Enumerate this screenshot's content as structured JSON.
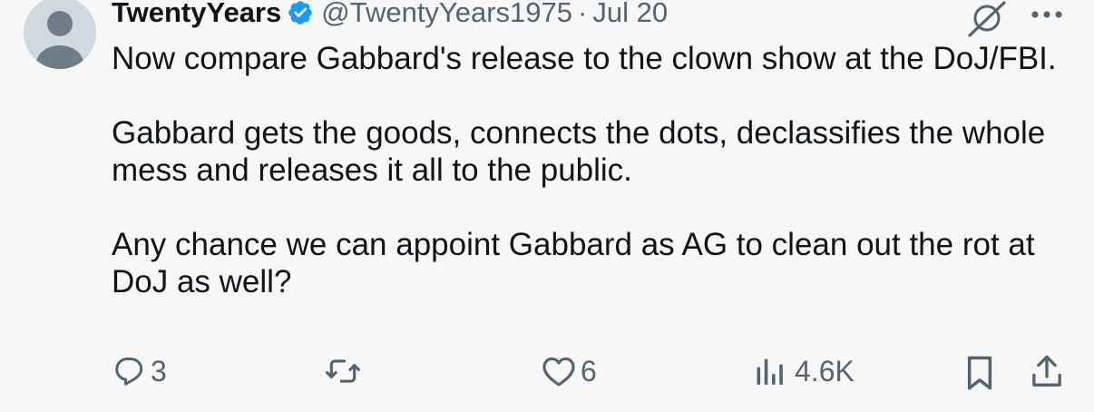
{
  "tweet": {
    "author": {
      "display_name": "TwentyYears",
      "handle": "@TwentyYears1975",
      "verified": true
    },
    "separator": "·",
    "date": "Jul 20",
    "paragraphs": [
      "Now compare Gabbard's release to the clown show at the DoJ/FBI.",
      "Gabbard gets the goods, connects the dots, declassifies the whole mess and releases it all to the public.",
      "Any chance we can appoint Gabbard as AG to clean out the rot at DoJ as well?"
    ],
    "actions": {
      "replies": "3",
      "reposts": "",
      "likes": "6",
      "views": "4.6K"
    }
  },
  "icons": {
    "avatar": "default-avatar-icon",
    "verified": "verified-badge-icon",
    "grok": "grok-icon",
    "more": "more-horizontal-icon",
    "reply": "reply-icon",
    "repost": "repost-icon",
    "like": "heart-icon",
    "views": "views-chart-icon",
    "bookmark": "bookmark-icon",
    "share": "share-icon"
  },
  "colors": {
    "background": "#f7f7f7",
    "text_primary": "#0f1419",
    "text_secondary": "#536471",
    "verified_blue": "#1d9bf0",
    "avatar_bg": "#cfd9de",
    "avatar_fg": "#6e7d88"
  }
}
